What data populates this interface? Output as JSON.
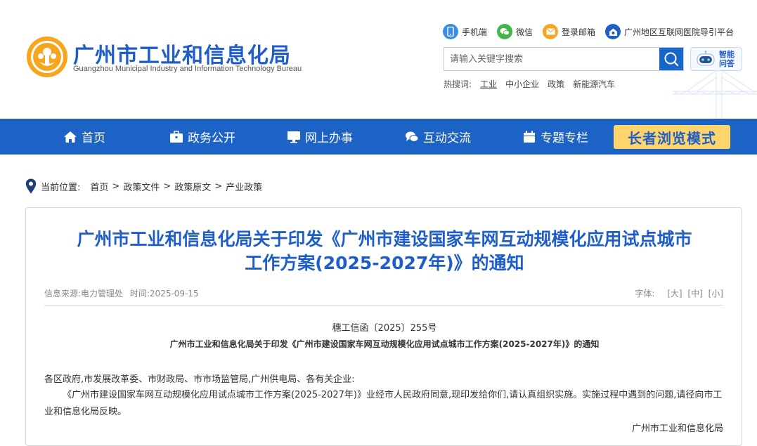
{
  "header": {
    "title_cn": "广州市工业和信息化局",
    "title_en": "Guangzhou Municipal Industry and Information Technology Bureau",
    "toplinks": [
      {
        "label": "手机端",
        "icon": "mobile-icon",
        "color": "#3a8ee6"
      },
      {
        "label": "微信",
        "icon": "wechat-icon",
        "color": "#43b649"
      },
      {
        "label": "登录邮箱",
        "icon": "mail-icon",
        "color": "#f5a623"
      },
      {
        "label": "广州地区互联网医院导引平台",
        "icon": "hospital-icon",
        "color": "#1f5ec8"
      }
    ],
    "search": {
      "placeholder": "请输入关键字搜索"
    },
    "ai_label": "智能问答",
    "hot": {
      "label": "热搜词:",
      "items": [
        "工业",
        "中小企业",
        "政策",
        "新能源汽车"
      ]
    }
  },
  "nav": {
    "items": [
      {
        "label": "首页",
        "icon": "home-icon"
      },
      {
        "label": "政务公开",
        "icon": "briefcase-icon"
      },
      {
        "label": "网上办事",
        "icon": "monitor-icon"
      },
      {
        "label": "互动交流",
        "icon": "chat-icon"
      },
      {
        "label": "专题专栏",
        "icon": "calendar-icon"
      }
    ],
    "elder_mode": "长者浏览模式",
    "color": "#1c63c5"
  },
  "breadcrumb": {
    "label": "当前位置:",
    "items": [
      "首页",
      "政策文件",
      "政策原文",
      "产业政策"
    ],
    "separator": ">"
  },
  "article": {
    "title_line1": "广州市工业和信息化局关于印发《广州市建设国家车网互动规模化应用试点城市",
    "title_line2": "工作方案(2025-2027年)》的通知",
    "source": "信息来源:电力管理处",
    "time": "时间:2025-09-15",
    "font_label": "字体:",
    "font_sizes": [
      "[大]",
      "[中]",
      "[小]"
    ],
    "doc_no": "穗工信函〔2025〕255号",
    "doc_title": "广州市工业和信息化局关于印发《广州市建设国家车网互动规模化应用试点城市工作方案(2025-2027年)》的通知",
    "recipients": "各区政府,市发展改革委、市财政局、市市场监管局,广州供电局、各有关企业:",
    "body": "《广州市建设国家车网互动规模化应用试点城市工作方案(2025-2027年)》业经市人民政府同意,现印发给你们,请认真组织实施。实施过程中遇到的问题,请径向市工业和信息化局反映。",
    "signature": "广州市工业和信息化局"
  }
}
